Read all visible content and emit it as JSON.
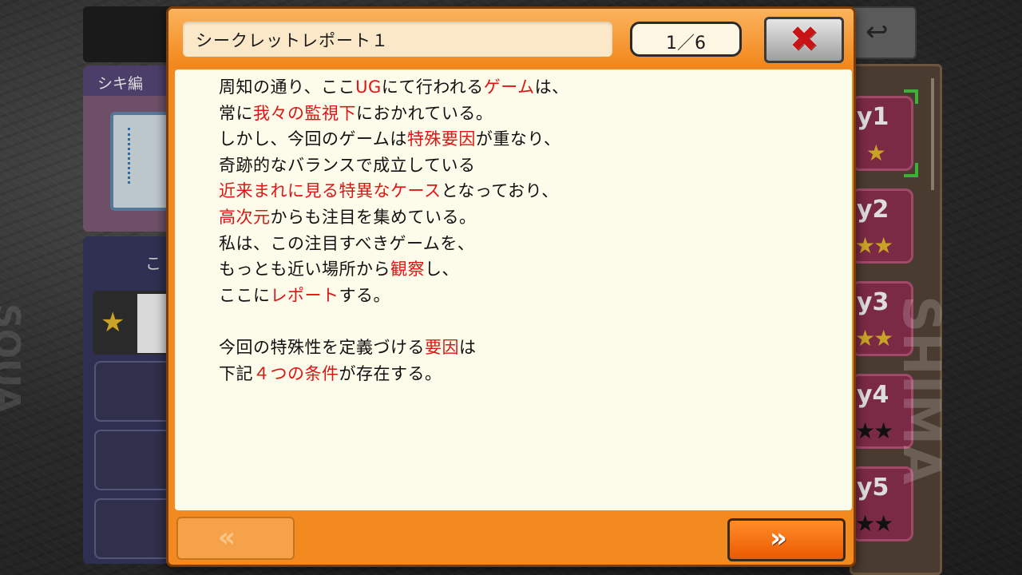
{
  "background": {
    "tab_label": "シキ編",
    "left_panel_label": "こ",
    "day_labels": [
      "y1",
      "y2",
      "y3",
      "y4",
      "y5"
    ],
    "watermark_right": "SHIMA",
    "watermark_left": "SQUA"
  },
  "modal": {
    "title": "シークレットレポート１",
    "page_indicator": "1／6",
    "close_icon": "close-x-icon",
    "prev_icon": "double-chevron-left-icon",
    "next_icon": "double-chevron-right-icon",
    "prev_label": "«",
    "next_label": "»",
    "close_label": "✖"
  },
  "report": {
    "lines": [
      {
        "segments": [
          {
            "t": "周知の通り、ここ"
          },
          {
            "t": "UG",
            "red": true
          },
          {
            "t": "にて行われる"
          },
          {
            "t": "ゲーム",
            "red": true
          },
          {
            "t": "は、"
          }
        ]
      },
      {
        "segments": [
          {
            "t": "常に"
          },
          {
            "t": "我々の監視下",
            "red": true
          },
          {
            "t": "におかれている。"
          }
        ]
      },
      {
        "segments": [
          {
            "t": "しかし、今回のゲームは"
          },
          {
            "t": "特殊要因",
            "red": true
          },
          {
            "t": "が重なり、"
          }
        ]
      },
      {
        "segments": [
          {
            "t": "奇跡的なバランスで成立している"
          }
        ]
      },
      {
        "segments": [
          {
            "t": "近来まれに見る特異なケース",
            "red": true
          },
          {
            "t": "となっており、"
          }
        ]
      },
      {
        "segments": [
          {
            "t": "高次元",
            "red": true
          },
          {
            "t": "からも注目を集めている。"
          }
        ]
      },
      {
        "segments": [
          {
            "t": "私は、この注目すべきゲームを、"
          }
        ]
      },
      {
        "segments": [
          {
            "t": "もっとも近い場所から"
          },
          {
            "t": "観察",
            "red": true
          },
          {
            "t": "し、"
          }
        ]
      },
      {
        "segments": [
          {
            "t": "ここに"
          },
          {
            "t": "レポート",
            "red": true
          },
          {
            "t": "する。"
          }
        ]
      },
      {
        "segments": []
      },
      {
        "segments": [
          {
            "t": "今回の特殊性を定義づける"
          },
          {
            "t": "要因",
            "red": true
          },
          {
            "t": "は"
          }
        ]
      },
      {
        "segments": [
          {
            "t": "下記"
          },
          {
            "t": "４つの条件",
            "red": true
          },
          {
            "t": "が存在する。"
          }
        ]
      }
    ]
  },
  "colors": {
    "accent_red": "#e01414",
    "modal_orange": "#f38a1f"
  }
}
